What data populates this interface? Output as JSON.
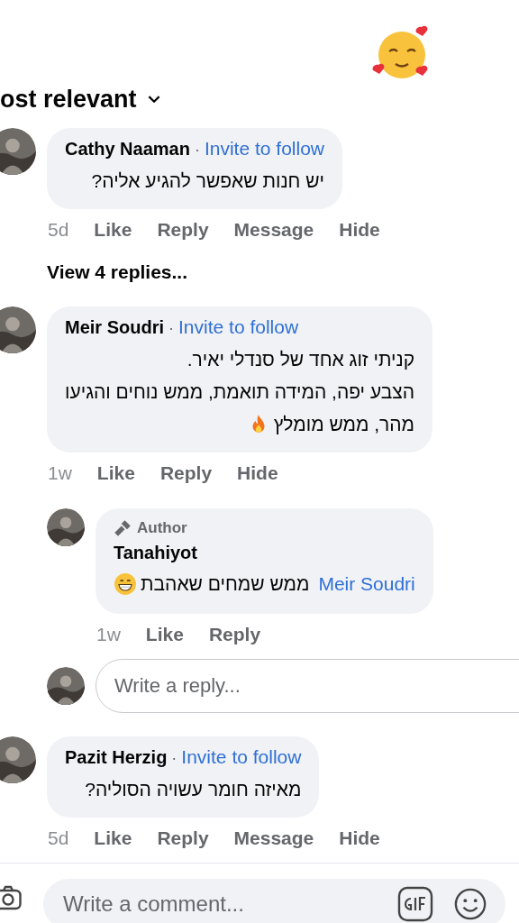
{
  "sort": {
    "label": "ost relevant"
  },
  "comments": [
    {
      "author": "Cathy Naaman",
      "separator": "·",
      "invite": "Invite to follow",
      "lines": [
        "יש חנות שאפשר להגיע אליה?"
      ],
      "has_emoji": false,
      "time": "5d",
      "actions": [
        "Like",
        "Reply",
        "Message",
        "Hide"
      ],
      "view_replies": "View 4 replies..."
    },
    {
      "author": "Meir Soudri",
      "separator": "·",
      "invite": "Invite to follow",
      "lines": [
        "קניתי זוג אחד של סנדלי יאיר.",
        "הצבע יפה, המידה תואמת, ממש נוחים והגיעו",
        "מהר, ממש מומלץ"
      ],
      "has_emoji": true,
      "time": "1w",
      "actions": [
        "Like",
        "Reply",
        "Hide"
      ],
      "replies": [
        {
          "badge": "Author",
          "author": "Tanahiyot",
          "mention": "Meir Soudri",
          "text": "ממש שמחים שאהבת",
          "has_emoji": true,
          "time": "1w",
          "actions": [
            "Like",
            "Reply"
          ]
        }
      ],
      "reply_box": {
        "placeholder": "Write a reply..."
      }
    },
    {
      "author": "Pazit Herzig",
      "separator": "·",
      "invite": "Invite to follow",
      "lines": [
        "מאיזה חומר עשויה הסוליה?"
      ],
      "has_emoji": false,
      "time": "5d",
      "actions": [
        "Like",
        "Reply",
        "Message",
        "Hide"
      ]
    }
  ],
  "composer": {
    "placeholder": "Write a comment..."
  }
}
